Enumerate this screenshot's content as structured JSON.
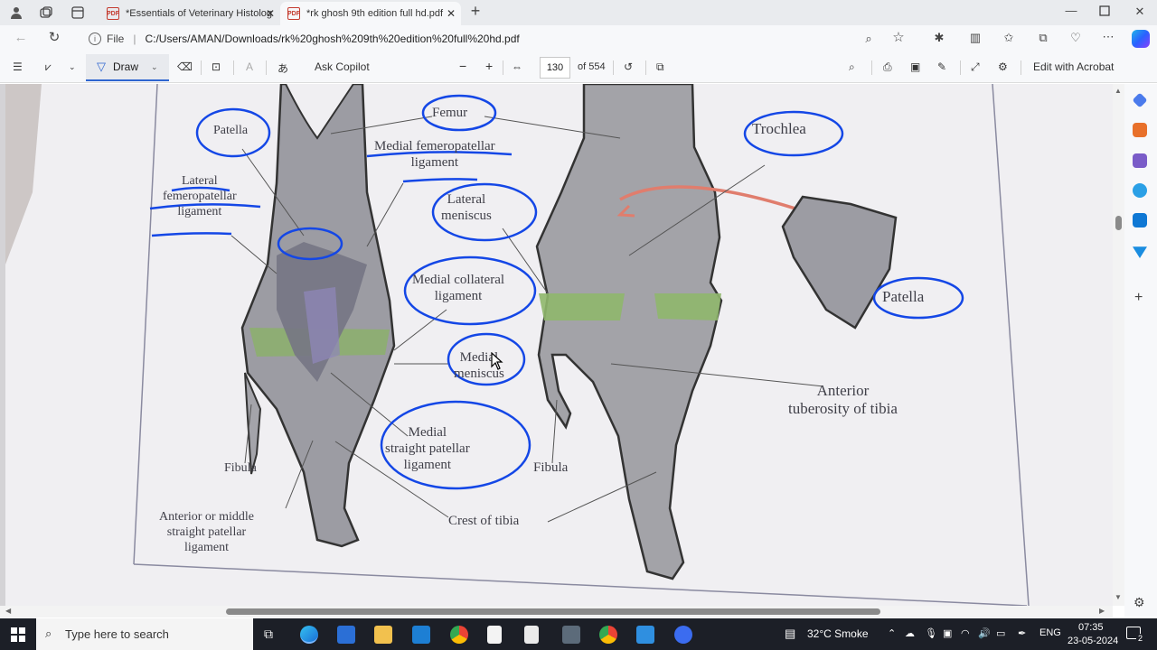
{
  "tabs": [
    {
      "title": "*Essentials of Veterinary Histolog",
      "icon": "pdf-icon",
      "active": false
    },
    {
      "title": "*rk ghosh 9th edition full hd.pdf",
      "icon": "pdf-icon",
      "active": true
    }
  ],
  "address": {
    "scheme_label": "File",
    "url": "C:/Users/AMAN/Downloads/rk%20ghosh%209th%20edition%20full%20hd.pdf"
  },
  "pdf_toolbar": {
    "draw_label": "Draw",
    "ask_copilot": "Ask Copilot",
    "page_number": "130",
    "page_total": "of 554",
    "edit_acrobat": "Edit with Acrobat"
  },
  "figure": {
    "labels": {
      "femur": "Femur",
      "patella_left": "Patella",
      "lateral_fp_lig": "Lateral\nfemeropatellar\nligament",
      "medial_fp_lig": "Medial femeropatellar\nligament",
      "lateral_meniscus": "Lateral\nmeniscus",
      "medial_collateral": "Medial collateral\nligament",
      "medial_meniscus": "Medial\nmeniscus",
      "medial_straight": "Medial\nstraight patellar\nligament",
      "fibula_left": "Fibula",
      "anterior_middle": "Anterior or middle\nstraight patellar\nligament",
      "crest_tibia": "Crest of tibia",
      "fibula_right": "Fibula",
      "trochlea": "Trochlea",
      "patella_right": "Patella",
      "anterior_tuberosity": "Anterior\ntuberosity of tibia"
    },
    "annotation_color": "#1447e6"
  },
  "taskbar": {
    "search_placeholder": "Type here to search",
    "weather": "32°C  Smoke",
    "language": "ENG",
    "time": "07:35",
    "date": "23-05-2024",
    "notification_count": "2"
  }
}
